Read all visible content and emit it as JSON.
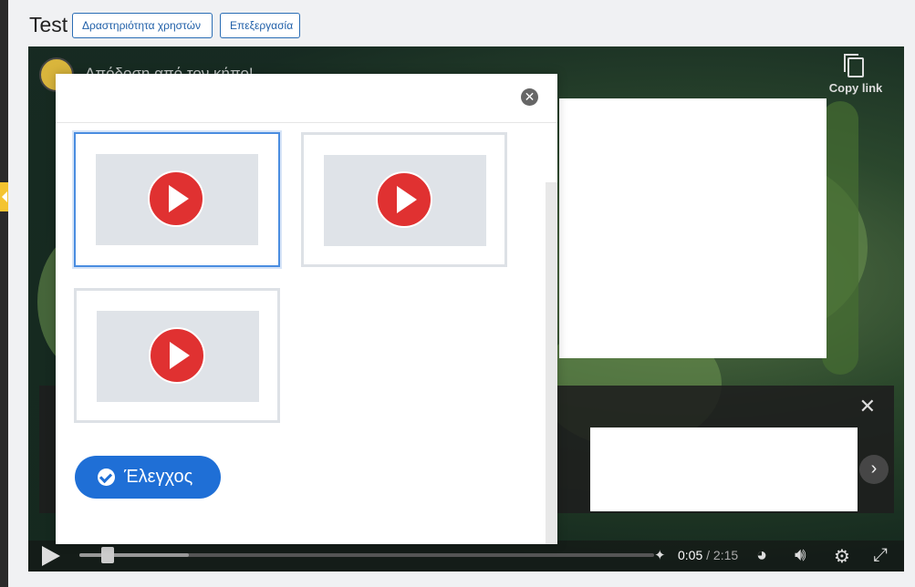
{
  "header": {
    "title": "Test",
    "activity_button": "Δραστηριότητα χρηστών",
    "edit_button": "Επεξεργασία"
  },
  "player": {
    "video_title": "Απόδοση από τον κήπο!",
    "copy_link": "Copy link",
    "more_videos_close": "✕",
    "next_arrow": "›",
    "progress": 0.038,
    "buffered": 0.19,
    "current_time": "0:05",
    "time_separator": " / ",
    "duration": "2:15",
    "icons": [
      "play-icon",
      "stats-icon",
      "volume-icon",
      "settings-icon",
      "fullscreen-icon",
      "copy-icon"
    ]
  },
  "modal": {
    "close": "✕",
    "videos": [
      {
        "selected": true
      },
      {
        "selected": false
      },
      {
        "selected": false
      }
    ],
    "check_button": "Έλεγχος"
  },
  "colors": {
    "accent": "#1f6fd6",
    "play_red": "#e03131",
    "selected_border": "#4a8de0"
  }
}
